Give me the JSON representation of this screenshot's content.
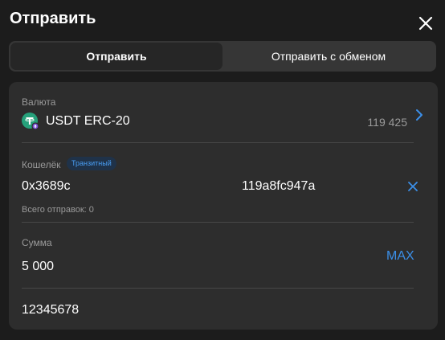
{
  "header": {
    "title": "Отправить"
  },
  "tabs": [
    {
      "label": "Отправить",
      "active": true
    },
    {
      "label": "Отправить с обменом",
      "active": false
    }
  ],
  "currency": {
    "label": "Валюта",
    "name": "USDT ERC-20",
    "balance": "119 425",
    "icon": "tether-icon"
  },
  "wallet": {
    "label": "Кошелёк",
    "badge": "Транзитный",
    "address_start": "0x3689c",
    "address_end": "119a8fc947a",
    "total_sends": "Всего отправок: 0"
  },
  "amount": {
    "label": "Сумма",
    "value": "5 000",
    "max_label": "MAX"
  },
  "memo": {
    "value": "12345678"
  },
  "colors": {
    "accent": "#3b8fe8",
    "tether": "#26a17b",
    "badge_bg": "#1f3249"
  }
}
